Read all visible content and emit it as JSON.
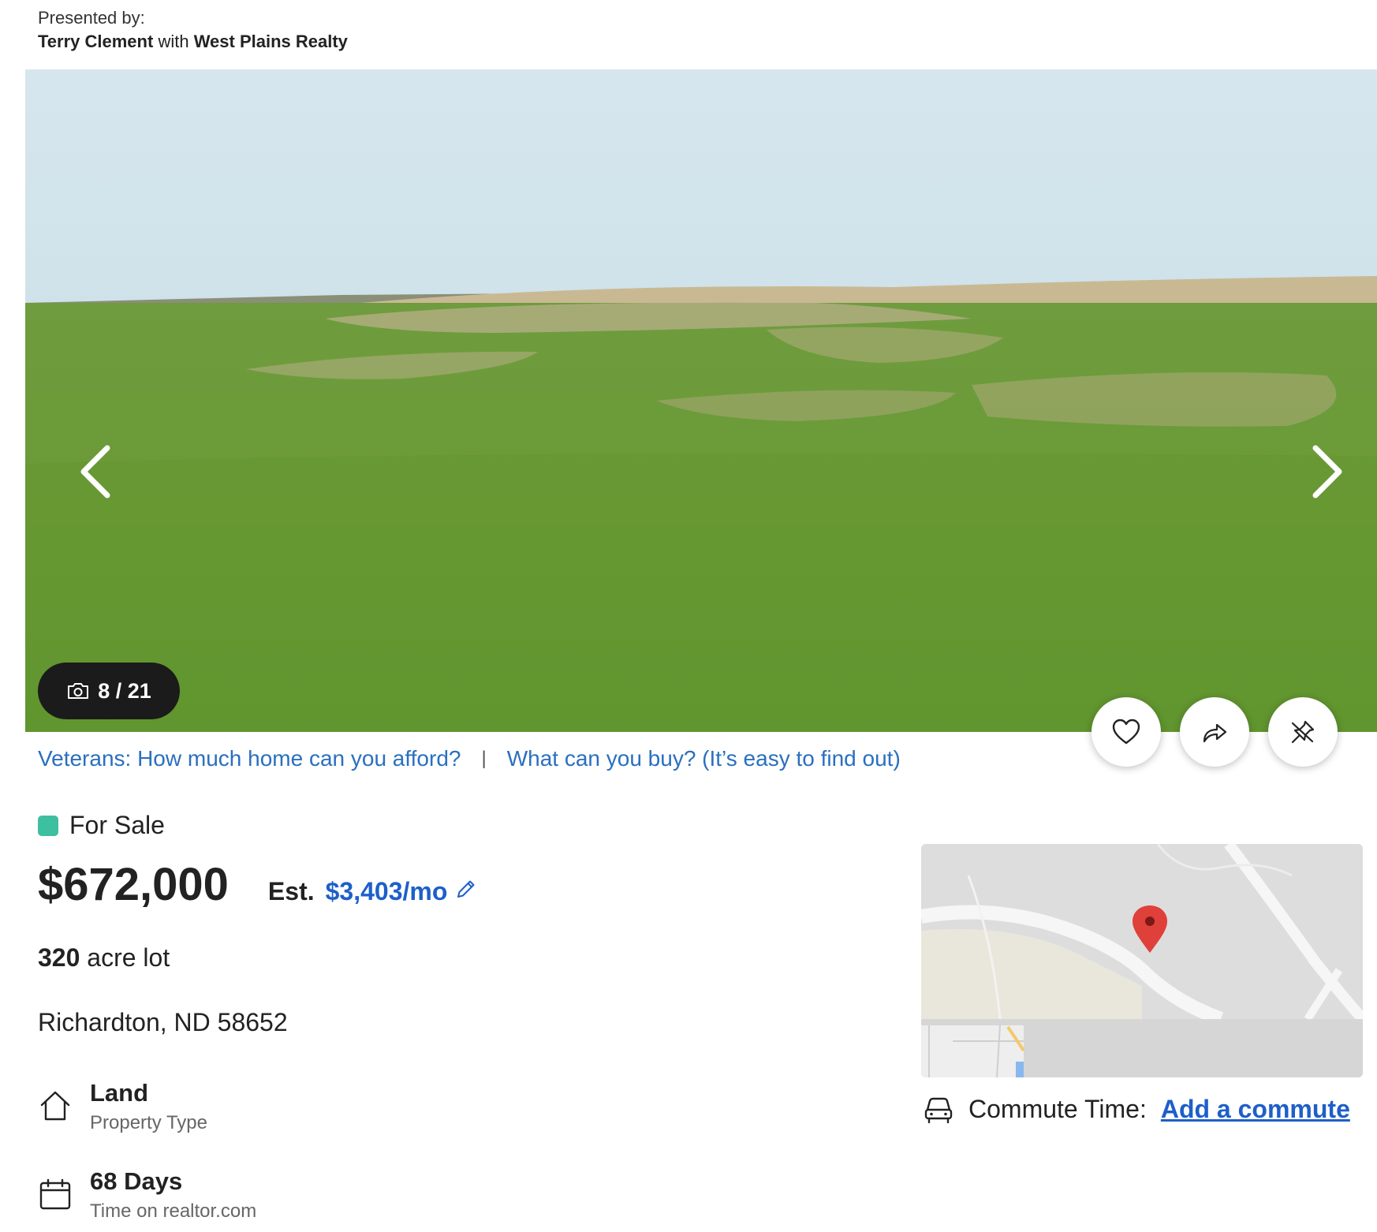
{
  "presented_by": {
    "label": "Presented by:",
    "agent": "Terry Clement",
    "connector": "with",
    "brokerage": "West Plains Realty"
  },
  "gallery": {
    "current": "8",
    "total": "21",
    "counter_text": "8 / 21",
    "prev_icon": "chevron-left-icon",
    "next_icon": "chevron-right-icon"
  },
  "actions": [
    {
      "name": "save",
      "icon": "heart-icon"
    },
    {
      "name": "share",
      "icon": "share-arrow-icon"
    },
    {
      "name": "hide",
      "icon": "pin-off-icon"
    }
  ],
  "promo_links": {
    "veterans": "Veterans: How much home can you afford?",
    "separator": "|",
    "buy": "What can you buy? (It’s easy to find out)"
  },
  "listing": {
    "status": "For Sale",
    "status_color": "#3dbfa0",
    "price": "$672,000",
    "est_label": "Est.",
    "est_amount": "$3,403/mo",
    "lot_size": "320",
    "lot_unit": "acre lot",
    "address": "Richardton, ND 58652"
  },
  "facts": {
    "type_value": "Land",
    "type_label": "Property Type",
    "days_value": "68 Days",
    "days_label": "Time on realtor.com"
  },
  "commute": {
    "label": "Commute Time:",
    "link": "Add a commute"
  },
  "colors": {
    "link_blue": "#1e5fc9",
    "promo_blue": "#2a6fbf",
    "text": "#222222",
    "map_pin": "#e0403a"
  }
}
